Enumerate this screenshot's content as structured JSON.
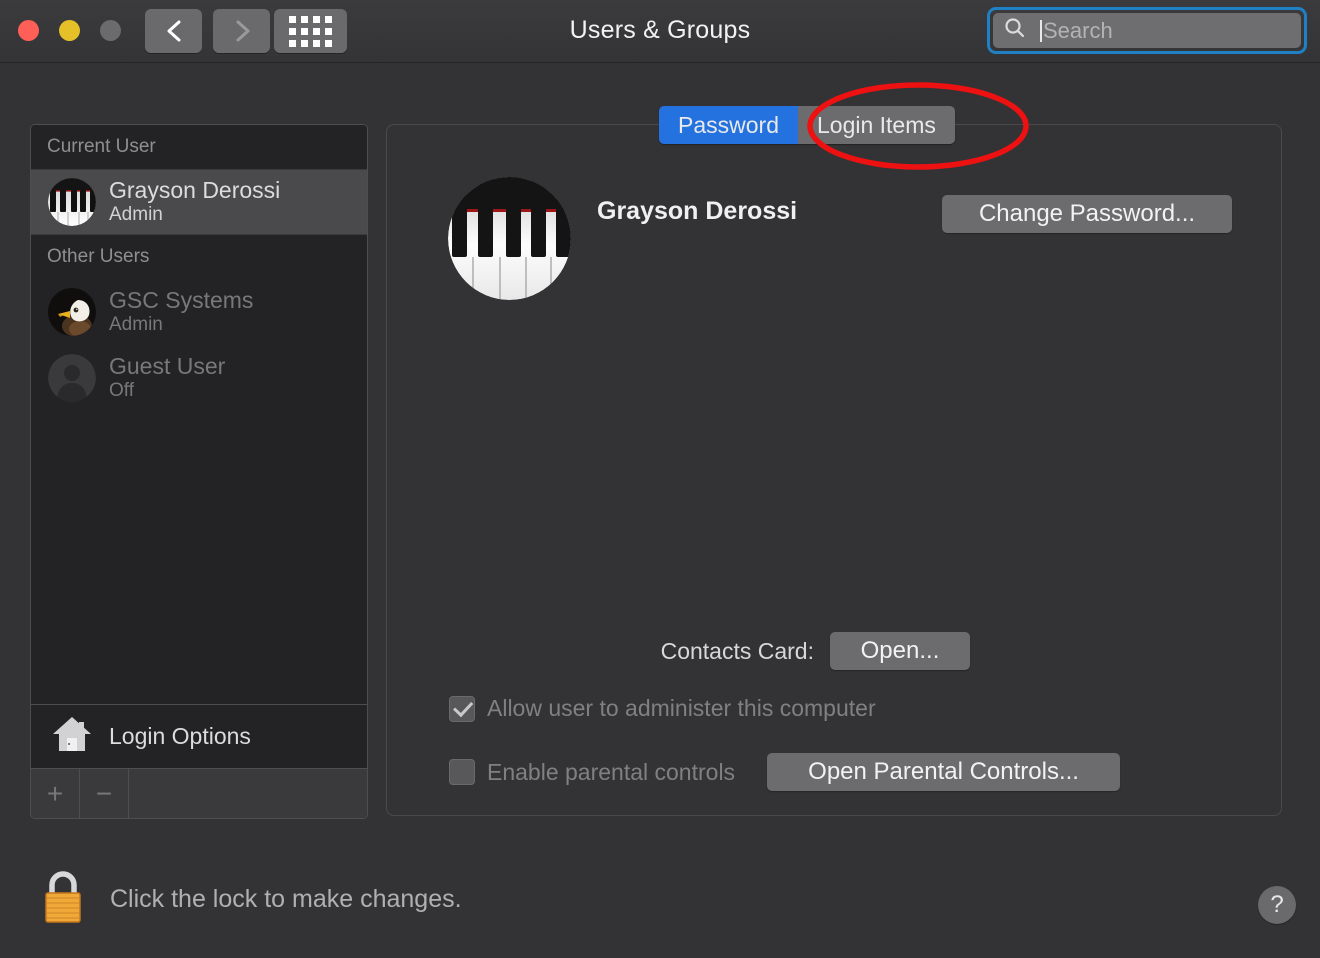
{
  "window": {
    "title": "Users & Groups",
    "traffic_lights": [
      {
        "name": "close",
        "color": "#ff5f57"
      },
      {
        "name": "minimize",
        "color": "#e5c028"
      },
      {
        "name": "zoom",
        "color": "#6b6b6d"
      }
    ],
    "nav": {
      "back_icon": "chevron-left-icon",
      "forward_icon": "chevron-right-icon",
      "show_all_icon": "grid-icon"
    }
  },
  "search": {
    "placeholder": "Search",
    "value": "",
    "icon": "search-icon",
    "focus_ring_color": "#1f80c4"
  },
  "sidebar": {
    "groups": [
      {
        "header": "Current User",
        "users": [
          {
            "name": "Grayson Derossi",
            "role": "Admin",
            "avatar": "piano-keys-avatar",
            "selected": true,
            "dimmed": false
          }
        ]
      },
      {
        "header": "Other Users",
        "users": [
          {
            "name": "GSC Systems",
            "role": "Admin",
            "avatar": "eagle-avatar",
            "selected": false,
            "dimmed": true
          },
          {
            "name": "Guest User",
            "role": "Off",
            "avatar": "person-silhouette-avatar",
            "selected": false,
            "dimmed": true
          }
        ]
      }
    ],
    "login_options": {
      "label": "Login Options",
      "icon": "house-icon"
    },
    "toolbar": {
      "add_label": "+",
      "remove_label": "−",
      "add_icon": "plus-icon",
      "remove_icon": "minus-icon"
    }
  },
  "tabs": [
    {
      "label": "Password",
      "active": true,
      "color": "#2372e0"
    },
    {
      "label": "Login Items",
      "active": false,
      "color": "#6c6c6e"
    }
  ],
  "annotation": {
    "shape": "ellipse",
    "color": "#ee1111",
    "target": "Login Items"
  },
  "account": {
    "avatar": "piano-keys-avatar",
    "name": "Grayson Derossi",
    "change_password_label": "Change Password...",
    "contacts_card_label": "Contacts Card:",
    "contacts_open_label": "Open...",
    "admin_checkbox": {
      "label": "Allow user to administer this computer",
      "checked": true,
      "enabled": false
    },
    "parental_checkbox": {
      "label": "Enable parental controls",
      "checked": false,
      "enabled": false
    },
    "parental_button_label": "Open Parental Controls..."
  },
  "footer": {
    "lock_text": "Click the lock to make changes.",
    "lock_icon": "lock-closed-icon",
    "help_label": "?",
    "help_icon": "help-icon"
  }
}
